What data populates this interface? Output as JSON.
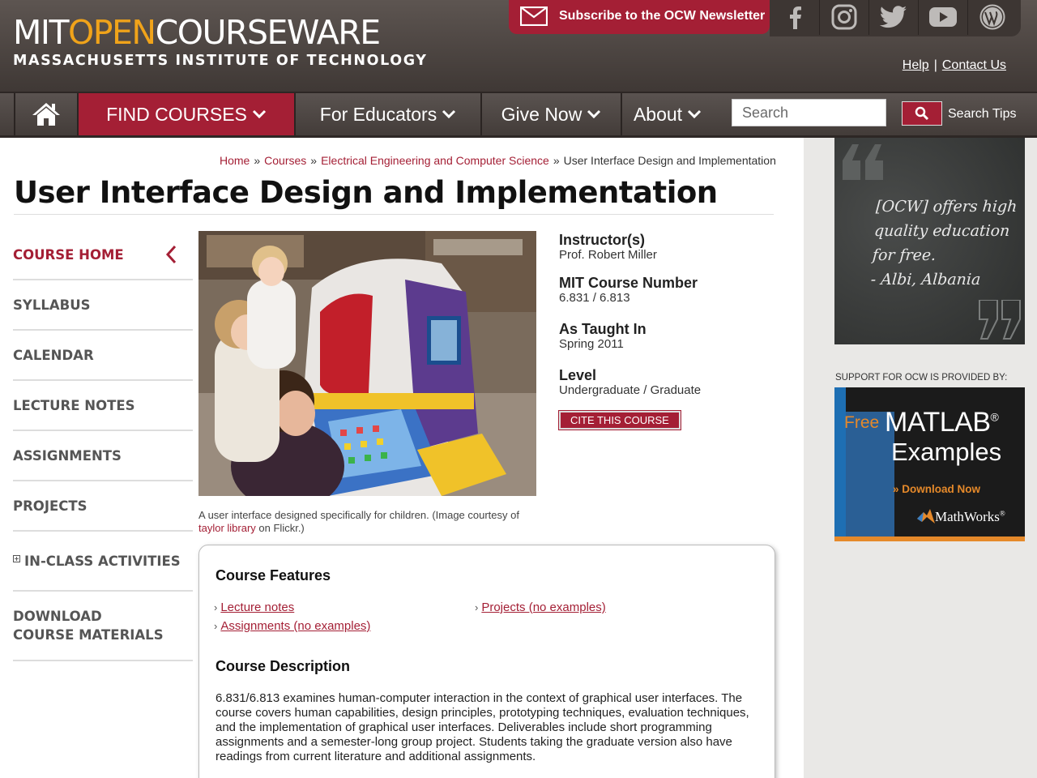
{
  "header": {
    "logo_mit": "MIT",
    "logo_open": "OPEN",
    "logo_courseware": "COURSEWARE",
    "logo_subtitle": "MASSACHUSETTS INSTITUTE OF TECHNOLOGY",
    "subscribe_label": "Subscribe to the OCW Newsletter",
    "social": [
      "facebook-icon",
      "instagram-icon",
      "twitter-icon",
      "youtube-icon",
      "wordpress-icon"
    ],
    "help_label": "Help",
    "separator": "|",
    "contact_label": "Contact Us"
  },
  "nav": {
    "home_icon": "home-icon",
    "find_courses": "FIND COURSES",
    "for_educators": "For Educators",
    "give_now": "Give Now",
    "about": "About",
    "search_placeholder": "Search",
    "search_tips": "Search Tips"
  },
  "breadcrumb": {
    "home": "Home",
    "courses": "Courses",
    "department": "Electrical Engineering and Computer Science",
    "current": "User Interface Design and Implementation",
    "sep": "»"
  },
  "page_title": "User Interface Design and Implementation",
  "sidebar": {
    "items": [
      {
        "label": "COURSE HOME"
      },
      {
        "label": "SYLLABUS"
      },
      {
        "label": "CALENDAR"
      },
      {
        "label": "LECTURE NOTES"
      },
      {
        "label": "ASSIGNMENTS"
      },
      {
        "label": "PROJECTS"
      },
      {
        "label": "IN-CLASS ACTIVITIES"
      },
      {
        "label": "DOWNLOAD COURSE MATERIALS"
      }
    ]
  },
  "image": {
    "caption_text": "A user interface designed specifically for children. (Image courtesy of",
    "caption_link": "taylor library",
    "caption_end": "on Flickr.)"
  },
  "course_info": {
    "instructor_label": "Instructor(s)",
    "instructor_value": "Prof. Robert Miller",
    "number_label": "MIT Course Number",
    "number_value": "6.831 / 6.813",
    "taught_label": "As Taught In",
    "taught_value": "Spring 2011",
    "level_label": "Level",
    "level_value": "Undergraduate / Graduate",
    "cite_label": "CITE THIS COURSE"
  },
  "features": {
    "heading": "Course Features",
    "arrow": "›",
    "links": [
      "Lecture notes",
      "Assignments (no examples)",
      "Projects (no examples)"
    ]
  },
  "description": {
    "heading": "Course Description",
    "text": "6.831/6.813 examines human-computer interaction in the context of graphical user interfaces. The course covers human capabilities, design principles, prototyping techniques, evaluation techniques, and the implementation of graphical user interfaces. Deliverables include short programming assignments and a semester-long group project. Students taking the graduate version also have readings from current literature and additional assignments."
  },
  "right": {
    "quote": "[OCW] offers high\nquality education\nfor free.\n- Albi, Albania",
    "support_label": "SUPPORT FOR OCW IS PROVIDED BY:",
    "ad_free": "Free",
    "ad_matlab": "MATLAB",
    "ad_registered": "®",
    "ad_examples": "Examples",
    "ad_download": "» Download Now",
    "ad_mathworks": "MathWorks",
    "ad_mathworks_reg": "®"
  },
  "colors": {
    "brand_red": "#a41f35",
    "header_gray": "#4e4744",
    "logo_orange": "#f0a31a"
  }
}
